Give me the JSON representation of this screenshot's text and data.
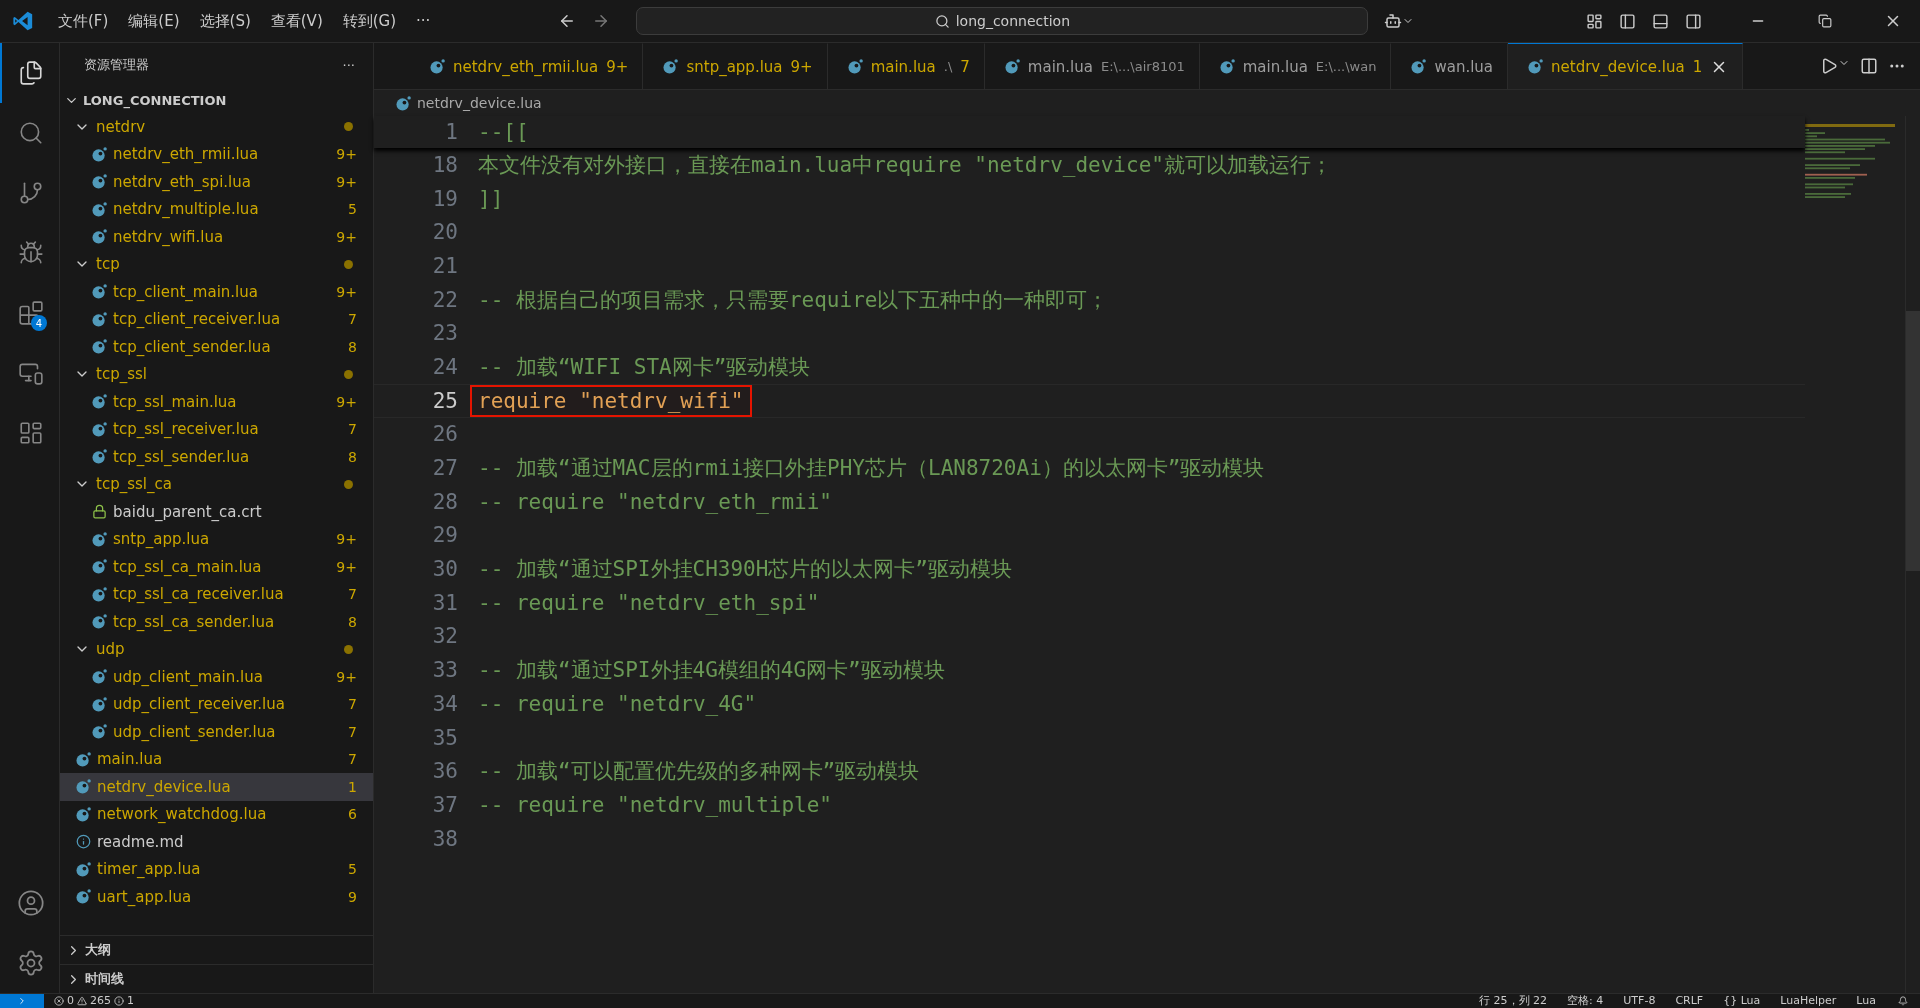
{
  "menu": [
    "文件(F)",
    "编辑(E)",
    "选择(S)",
    "查看(V)",
    "转到(G)",
    "···"
  ],
  "command_center": {
    "value": "long_connection"
  },
  "activity_bar": [
    {
      "kind": "files",
      "selected": true
    },
    {
      "kind": "search",
      "selected": false
    },
    {
      "kind": "source",
      "selected": false
    },
    {
      "kind": "debug",
      "selected": false
    },
    {
      "kind": "extensions",
      "selected": false,
      "badge": "4"
    },
    {
      "kind": "remote",
      "selected": false
    },
    {
      "kind": "docker",
      "selected": false
    }
  ],
  "sidebar": {
    "title": "资源管理器",
    "more": "···",
    "root": "LONG_CONNECTION",
    "items": [
      {
        "kind": "folder",
        "name": "netdrv",
        "expanded": true,
        "children": [
          {
            "kind": "lua",
            "name": "netdrv_eth_rmii.lua",
            "badge": "9+",
            "warning": true,
            "selected": false
          },
          {
            "kind": "lua",
            "name": "netdrv_eth_spi.lua",
            "badge": "9+",
            "warning": true,
            "selected": false
          },
          {
            "kind": "lua",
            "name": "netdrv_multiple.lua",
            "badge": "5",
            "warning": true,
            "selected": false
          },
          {
            "kind": "lua",
            "name": "netdrv_wifi.lua",
            "badge": "9+",
            "warning": true,
            "selected": false
          }
        ]
      },
      {
        "kind": "folder",
        "name": "tcp",
        "expanded": true,
        "children": [
          {
            "kind": "lua",
            "name": "tcp_client_main.lua",
            "badge": "9+",
            "warning": true,
            "selected": false
          },
          {
            "kind": "lua",
            "name": "tcp_client_receiver.lua",
            "badge": "7",
            "warning": true,
            "selected": false
          },
          {
            "kind": "lua",
            "name": "tcp_client_sender.lua",
            "badge": "8",
            "warning": true,
            "selected": false
          }
        ]
      },
      {
        "kind": "folder",
        "name": "tcp_ssl",
        "expanded": true,
        "children": [
          {
            "kind": "lua",
            "name": "tcp_ssl_main.lua",
            "badge": "9+",
            "warning": true,
            "selected": false
          },
          {
            "kind": "lua",
            "name": "tcp_ssl_receiver.lua",
            "badge": "7",
            "warning": true,
            "selected": false
          },
          {
            "kind": "lua",
            "name": "tcp_ssl_sender.lua",
            "badge": "8",
            "warning": true,
            "selected": false
          }
        ]
      },
      {
        "kind": "folder",
        "name": "tcp_ssl_ca",
        "expanded": true,
        "children": [
          {
            "kind": "cert",
            "name": "baidu_parent_ca.crt",
            "warning": false,
            "selected": false
          },
          {
            "kind": "lua",
            "name": "sntp_app.lua",
            "badge": "9+",
            "warning": true,
            "selected": false
          },
          {
            "kind": "lua",
            "name": "tcp_ssl_ca_main.lua",
            "badge": "9+",
            "warning": true,
            "selected": false
          },
          {
            "kind": "lua",
            "name": "tcp_ssl_ca_receiver.lua",
            "badge": "7",
            "warning": true,
            "selected": false
          },
          {
            "kind": "lua",
            "name": "tcp_ssl_ca_sender.lua",
            "badge": "8",
            "warning": true,
            "selected": false
          }
        ]
      },
      {
        "kind": "folder",
        "name": "udp",
        "expanded": true,
        "children": [
          {
            "kind": "lua",
            "name": "udp_client_main.lua",
            "badge": "9+",
            "warning": true,
            "selected": false
          },
          {
            "kind": "lua",
            "name": "udp_client_receiver.lua",
            "badge": "7",
            "warning": true,
            "selected": false
          },
          {
            "kind": "lua",
            "name": "udp_client_sender.lua",
            "badge": "7",
            "warning": true,
            "selected": false
          }
        ]
      },
      {
        "kind": "lua",
        "name": "main.lua",
        "badge": "7",
        "warning": true,
        "selected": false
      },
      {
        "kind": "lua",
        "name": "netdrv_device.lua",
        "badge": "1",
        "warning": true,
        "selected": true
      },
      {
        "kind": "lua",
        "name": "network_watchdog.lua",
        "badge": "6",
        "warning": true,
        "selected": false
      },
      {
        "kind": "info",
        "name": "readme.md",
        "warning": false,
        "selected": false
      },
      {
        "kind": "lua",
        "name": "timer_app.lua",
        "badge": "5",
        "warning": true,
        "selected": false
      },
      {
        "kind": "lua",
        "name": "uart_app.lua",
        "badge": "9",
        "warning": true,
        "selected": false
      }
    ],
    "sections": [
      {
        "title": "大纲",
        "expanded": false
      },
      {
        "title": "时间线",
        "expanded": false
      }
    ]
  },
  "tabs": [
    {
      "label": "netdrv_eth_rmii.lua",
      "badge": "9+",
      "warning": true,
      "selected": false
    },
    {
      "label": "sntp_app.lua",
      "badge": "9+",
      "warning": true,
      "selected": false
    },
    {
      "label": "main.lua",
      "description": ".\\",
      "badge": "7",
      "warning": true,
      "selected": false
    },
    {
      "label": "main.lua",
      "description": "E:\\...\\air8101",
      "warning": false,
      "selected": false
    },
    {
      "label": "main.lua",
      "description": "E:\\...\\wan",
      "warning": false,
      "selected": false
    },
    {
      "label": "wan.lua",
      "warning": false,
      "selected": false
    },
    {
      "label": "netdrv_device.lua",
      "badge": "1",
      "warning": true,
      "selected": true
    }
  ],
  "breadcrumb": "netdrv_device.lua",
  "sticky_line": {
    "number": "1",
    "text": "--[[",
    "kind": "comment"
  },
  "lines": [
    {
      "number": "18",
      "text": "本文件没有对外接口，直接在main.lua中require \"netdrv_device\"就可以加载运行；",
      "kind": "comment",
      "current": false
    },
    {
      "number": "19",
      "text": "]]",
      "kind": "comment",
      "current": false
    },
    {
      "number": "20",
      "current": false
    },
    {
      "number": "21",
      "current": false
    },
    {
      "number": "22",
      "text": "-- 根据自己的项目需求，只需要require以下五种中的一种即可；",
      "kind": "comment",
      "current": false
    },
    {
      "number": "23",
      "current": false
    },
    {
      "number": "24",
      "text": "-- 加载“WIFI STA网卡”驱动模块",
      "kind": "comment",
      "current": false
    },
    {
      "number": "25",
      "text": "require \"netdrv_wifi\"",
      "kind": "code",
      "highlighted": true,
      "current": true
    },
    {
      "number": "26",
      "current": false
    },
    {
      "number": "27",
      "text": "-- 加载“通过MAC层的rmii接口外挂PHY芯片（LAN8720Ai）的以太网卡”驱动模块",
      "kind": "comment",
      "current": false
    },
    {
      "number": "28",
      "text": "-- require \"netdrv_eth_rmii\"",
      "kind": "comment",
      "current": false
    },
    {
      "number": "29",
      "current": false
    },
    {
      "number": "30",
      "text": "-- 加载“通过SPI外挂CH390H芯片的以太网卡”驱动模块",
      "kind": "comment",
      "current": false
    },
    {
      "number": "31",
      "text": "-- require \"netdrv_eth_spi\"",
      "kind": "comment",
      "current": false
    },
    {
      "number": "32",
      "current": false
    },
    {
      "number": "33",
      "text": "-- 加载“通过SPI外挂4G模组的4G网卡”驱动模块",
      "kind": "comment",
      "current": false
    },
    {
      "number": "34",
      "text": "-- require \"netdrv_4G\"",
      "kind": "comment",
      "current": false
    },
    {
      "number": "35",
      "current": false
    },
    {
      "number": "36",
      "text": "-- 加载“可以配置优先级的多种网卡”驱动模块",
      "kind": "comment",
      "current": false
    },
    {
      "number": "37",
      "text": "-- require \"netdrv_multiple\"",
      "kind": "comment",
      "current": false
    },
    {
      "number": "38",
      "current": false
    }
  ],
  "status_bar": {
    "errors": "0",
    "warnings": "265",
    "infos": "1",
    "items": [
      "行 25，列 22",
      "空格: 4",
      "UTF-8",
      "CRLF",
      "{} Lua",
      "LuaHelper",
      "Lua"
    ]
  }
}
